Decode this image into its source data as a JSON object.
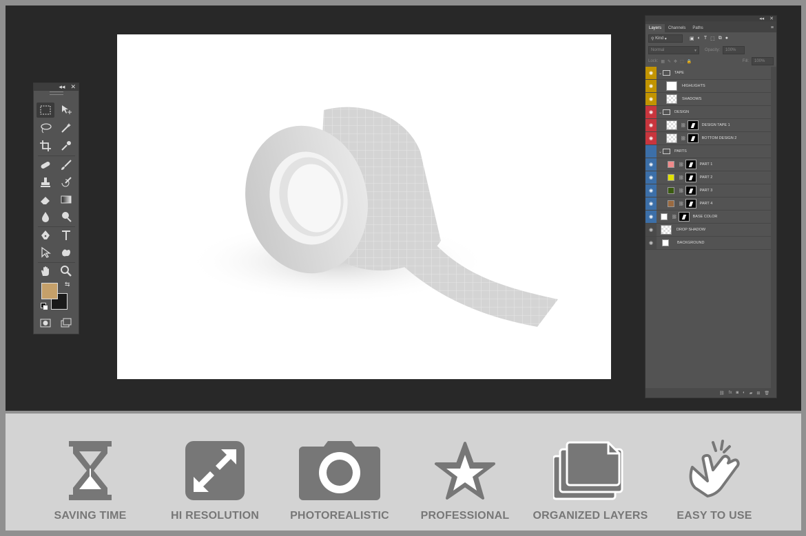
{
  "layers_panel": {
    "tabs": [
      "Layers",
      "Channels",
      "Paths"
    ],
    "filter_label": "Kind",
    "blend_mode": "Normal",
    "opacity_label": "Opacity:",
    "opacity_value": "100%",
    "lock_label": "Lock:",
    "fill_label": "Fill:",
    "fill_value": "100%",
    "layers": [
      {
        "name": "TAPE",
        "type": "group",
        "color": "#c29400"
      },
      {
        "name": "HIGHLIGHTS",
        "type": "layer",
        "color": "#c29400"
      },
      {
        "name": "SHADOWS",
        "type": "layer",
        "color": "#c29400"
      },
      {
        "name": "DESIGN",
        "type": "group",
        "color": "#c8353d"
      },
      {
        "name": "DESIGN TAPE 1",
        "type": "smart",
        "color": "#c8353d"
      },
      {
        "name": "BOTTOM DESIGN 2",
        "type": "smart",
        "color": "#c8353d"
      },
      {
        "name": "PARTS",
        "type": "group",
        "color": "#3c6fa8"
      },
      {
        "name": "PART 1",
        "type": "fill",
        "color": "#3c6fa8",
        "swatch": "#f08a8a"
      },
      {
        "name": "PART 2",
        "type": "fill",
        "color": "#3c6fa8",
        "swatch": "#e0e000"
      },
      {
        "name": "PART 3",
        "type": "fill",
        "color": "#3c6fa8",
        "swatch": "#3a5a10"
      },
      {
        "name": "PART 4",
        "type": "fill",
        "color": "#3c6fa8",
        "swatch": "#9a6a40"
      },
      {
        "name": "BASE COLOR",
        "type": "fill",
        "color": "#3c6fa8",
        "swatch": "#ffffff"
      },
      {
        "name": "DROP SHADOW",
        "type": "layer",
        "color": "none"
      },
      {
        "name": "BACKGROUND",
        "type": "plain",
        "color": "none"
      }
    ]
  },
  "toolbox": {
    "foreground_color": "#c5a06a",
    "background_color": "#1a1a1a"
  },
  "features": [
    {
      "label": "SAVING TIME",
      "icon": "hourglass-icon"
    },
    {
      "label": "HI RESOLUTION",
      "icon": "expand-arrows-icon"
    },
    {
      "label": "PHOTOREALISTIC",
      "icon": "camera-icon"
    },
    {
      "label": "PROFESSIONAL",
      "icon": "star-icon"
    },
    {
      "label": "ORGANIZED LAYERS",
      "icon": "stacked-folders-icon"
    },
    {
      "label": "EASY TO USE",
      "icon": "tap-hand-icon"
    }
  ]
}
